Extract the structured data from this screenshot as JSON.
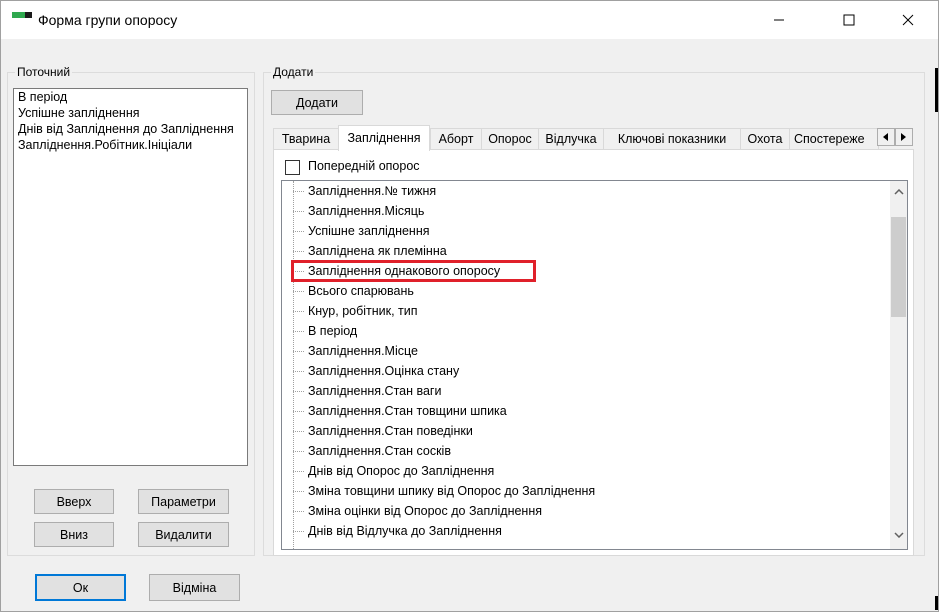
{
  "window": {
    "title": "Форма групи опоросу",
    "minimize_icon": "minimize-icon",
    "maximize_icon": "maximize-icon",
    "close_icon": "close-icon"
  },
  "current": {
    "label": "Поточний",
    "items": [
      "В період",
      "Успішне запліднення",
      "Днів від Запліднення  до Запліднення",
      "Запліднення.Робітник.Ініціали"
    ],
    "up_button": "Вверх",
    "params_button": "Параметри",
    "down_button": "Вниз",
    "delete_button": "Видалити"
  },
  "add": {
    "label": "Додати",
    "add_button": "Додати",
    "tabs": [
      "Тварина",
      "Запліднення",
      "Аборт",
      "Опорос",
      "Відлучка",
      "Ключові показники",
      "Охота",
      "Спостереже"
    ],
    "active_tab": "Запліднення",
    "previous_farrowing_checkbox": "Попередній опорос",
    "previous_farrowing_checked": false,
    "tree_items": [
      "Запліднення.№ тижня",
      "Запліднення.Місяць",
      "Успішне запліднення",
      "Запліднена як племінна",
      "Запліднення однакового опоросу",
      "Всього спарювань",
      "Кнур, робітник, тип",
      "В період",
      "Запліднення.Місце",
      "Запліднення.Оцінка стану",
      "Запліднення.Стан ваги",
      "Запліднення.Стан товщини шпика",
      "Запліднення.Стан поведінки",
      "Запліднення.Стан сосків",
      "Днів від Опорос  до Запліднення",
      "Зміна товщини шпику від Опорос до Запліднення",
      "Зміна оцінки від Опорос до Запліднення",
      "Днів від Відлучка  до Запліднення"
    ],
    "highlighted_item": "Запліднення однакового опоросу"
  },
  "footer": {
    "ok_button": "Ок",
    "cancel_button": "Відміна"
  },
  "colors": {
    "highlight": "#e0202a",
    "focus_border": "#0078d7",
    "icon_green": "#2fa84f"
  }
}
